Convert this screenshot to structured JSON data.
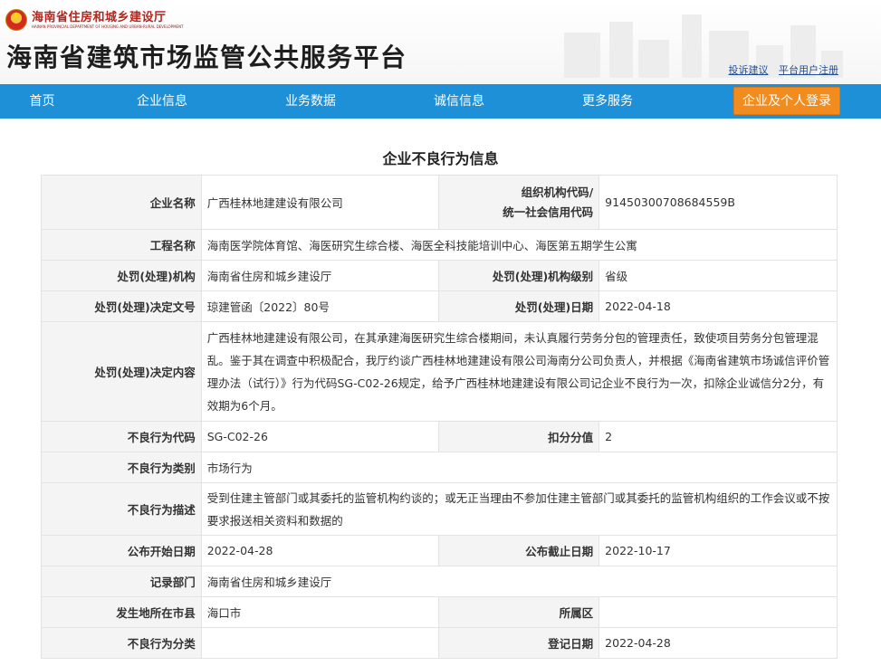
{
  "header": {
    "logo_cn": "海南省住房和城乡建设厅",
    "logo_en": "HAINAN PROVINCIAL DEPARTMENT OF HOUSING AND URBAN-RURAL DEVELOPMENT",
    "site_title": "海南省建筑市场监管公共服务平台",
    "links": [
      "投诉建议",
      "平台用户注册"
    ]
  },
  "nav": {
    "items": [
      "首页",
      "企业信息",
      "业务数据",
      "诚信信息",
      "更多服务"
    ],
    "login_label": "企业及个人登录"
  },
  "colors": {
    "nav_bg": "#1d90d8",
    "login_bg": "#f28c1e",
    "label_bg": "#f4f4f4"
  },
  "page_heading": "企业不良行为信息",
  "record": {
    "company_label": "企业名称",
    "company": "广西桂林地建建设有限公司",
    "org_code_label_1": "组织机构代码/",
    "org_code_label_2": "统一社会信用代码",
    "org_code": "91450300708684559B",
    "project_label": "工程名称",
    "project": "海南医学院体育馆、海医研究生综合楼、海医全科技能培训中心、海医第五期学生公寓",
    "authority_label": "处罚(处理)机构",
    "authority": "海南省住房和城乡建设厅",
    "authority_level_label": "处罚(处理)机构级别",
    "authority_level": "省级",
    "doc_no_label": "处罚(处理)决定文号",
    "doc_no": "琼建管函〔2022〕80号",
    "penalty_date_label": "处罚(处理)日期",
    "penalty_date": "2022-04-18",
    "decision_label": "处罚(处理)决定内容",
    "decision": "广西桂林地建建设有限公司，在其承建海医研究生综合楼期间，未认真履行劳务分包的管理责任，致使项目劳务分包管理混乱。鉴于其在调查中积极配合，我厅约谈广西桂林地建建设有限公司海南分公司负责人，并根据《海南省建筑市场诚信评价管理办法（试行）》行为代码SG-C02-26规定，给予广西桂林地建建设有限公司记企业不良行为一次，扣除企业诚信分2分，有效期为6个月。",
    "behavior_code_label": "不良行为代码",
    "behavior_code": "SG-C02-26",
    "deduct_label": "扣分分值",
    "deduct": "2",
    "behavior_type_label": "不良行为类别",
    "behavior_type": "市场行为",
    "behavior_desc_label": "不良行为描述",
    "behavior_desc": "受到住建主管部门或其委托的监管机构约谈的；或无正当理由不参加住建主管部门或其委托的监管机构组织的工作会议或不按要求报送相关资料和数据的",
    "publish_start_label": "公布开始日期",
    "publish_start": "2022-04-28",
    "publish_end_label": "公布截止日期",
    "publish_end": "2022-10-17",
    "record_dept_label": "记录部门",
    "record_dept": "海南省住房和城乡建设厅",
    "city_label": "发生地所在市县",
    "city": "海口市",
    "district_label": "所属区",
    "district": "",
    "category_label": "不良行为分类",
    "category": "",
    "register_date_label": "登记日期",
    "register_date": "2022-04-28"
  }
}
